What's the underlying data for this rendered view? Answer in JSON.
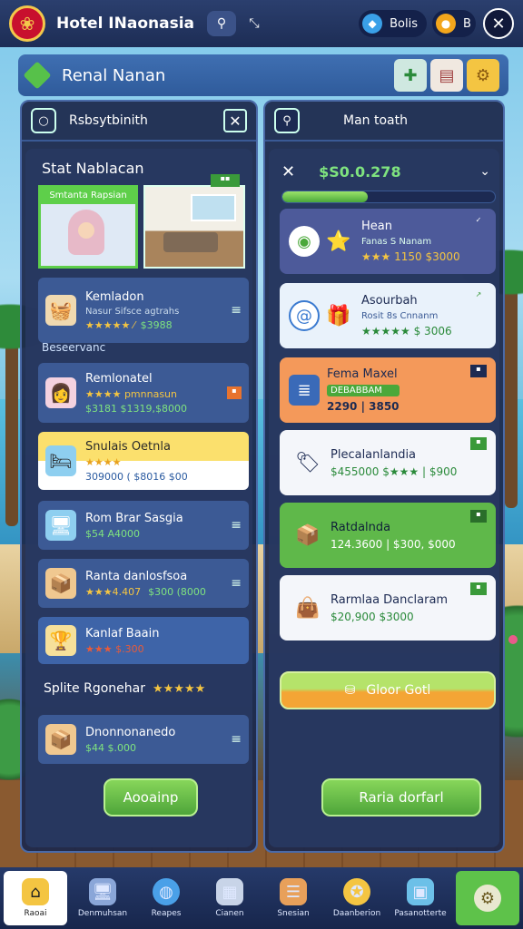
{
  "app": {
    "title": "Hotel INaonasia"
  },
  "topbar": {
    "currency_a": "Bolis",
    "currency_b_icon": "coin-icon"
  },
  "header": {
    "title": "Renal Nanan"
  },
  "left_panel": {
    "head_title": "Rsbsytbinith",
    "section_title": "Stat Nablacan",
    "photo_caption": "Smtanta Rapsian",
    "cards": [
      {
        "title": "Kemladon",
        "sub": "Nasur  Sifsce agtrahs",
        "rating": "★★★★★ ⁄",
        "price": "$3988"
      },
      {
        "title": "Remlonatel",
        "sub": "★★★★  pmnnasun",
        "rating": "",
        "price": "$3181 $1319,$8000"
      },
      {
        "title": "Snulais Oetnla",
        "sub": "",
        "rating": "★★★★",
        "price": "309000 ( $8016 $00"
      },
      {
        "title": "Rom Brar Sasgia",
        "sub": "",
        "rating": "",
        "price": "$54 A4000"
      },
      {
        "title": "Ranta danlosfsoa",
        "sub": "",
        "rating": "★★★4.407",
        "price": "$300 (8000"
      },
      {
        "title": "Kanlaf Baain",
        "sub": "",
        "rating": "★★★ $.300",
        "price": ""
      },
      {
        "title": "Dnonnonanedo",
        "sub": "",
        "rating": "",
        "price": "$44 $.000"
      }
    ],
    "loose_label": "Beseervanc",
    "row_text": "Splite Rgonehar",
    "row_stars": "★★★★★",
    "button": "Aooainp"
  },
  "right_panel": {
    "head_title": "Man toath",
    "balance": "$S0.0.278",
    "progress": 0.4,
    "offers": [
      {
        "title": "Hean",
        "meta": "Fanas  S Nanam",
        "price": "★★★ 1150 $3000"
      },
      {
        "title": "Asourbah",
        "meta": "Rosit  8s  Cnnanm",
        "price": "★★★★★  $ 3006"
      },
      {
        "title": "Fema Maxel",
        "meta": "DEBABBAM",
        "price": "2290 | 3850"
      },
      {
        "title": "Plecalanlandia",
        "meta": "",
        "price": "$455000  $★★★ | $900"
      },
      {
        "title": "Ratdalnda",
        "meta": "",
        "price": "124.3600 | $300, $000"
      },
      {
        "title": "Rarmlaa Danclaram",
        "meta": "",
        "price": "$20,900   $3000"
      }
    ],
    "cta": "Gloor Gotl",
    "button": "Raria dorfarl"
  },
  "nav": [
    {
      "label": "Raoai"
    },
    {
      "label": "Denmuhsan"
    },
    {
      "label": "Reapes"
    },
    {
      "label": "Cianen"
    },
    {
      "label": "Snesian"
    },
    {
      "label": "Daanberion"
    },
    {
      "label": "Pasanotterte"
    },
    {
      "label": ""
    }
  ]
}
